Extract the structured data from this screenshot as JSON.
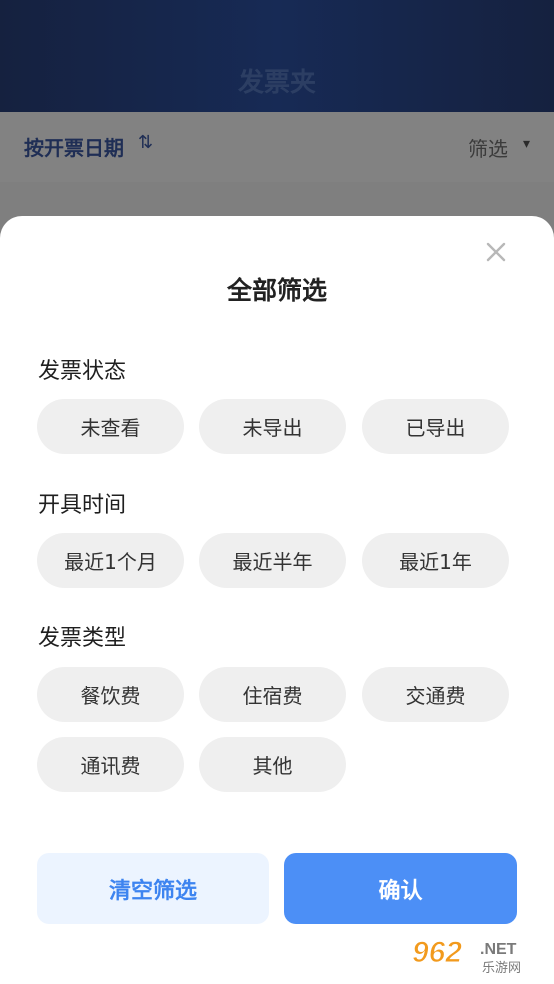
{
  "header": {
    "title": "发票夹"
  },
  "sort_bar": {
    "sort_label": "按开票日期",
    "sort_icon": "⇅",
    "filter_label": "筛选",
    "filter_caret": "▾"
  },
  "sheet": {
    "title": "全部筛选",
    "sections": [
      {
        "label": "发票状态",
        "options": [
          "未查看",
          "未导出",
          "已导出"
        ]
      },
      {
        "label": "开具时间",
        "options": [
          "最近1个月",
          "最近半年",
          "最近1年"
        ]
      },
      {
        "label": "发票类型",
        "options": [
          "餐饮费",
          "住宿费",
          "交通费",
          "通讯费",
          "其他"
        ]
      }
    ],
    "buttons": {
      "clear": "清空筛选",
      "confirm": "确认"
    }
  },
  "watermark": {
    "brand": "962",
    "suffix": ".NET",
    "sub": "乐游网"
  },
  "colors": {
    "accent": "#4c8ff6",
    "accent_light": "#ecf4ff",
    "chip_bg": "#efefef",
    "header_bg": "#172a55"
  }
}
